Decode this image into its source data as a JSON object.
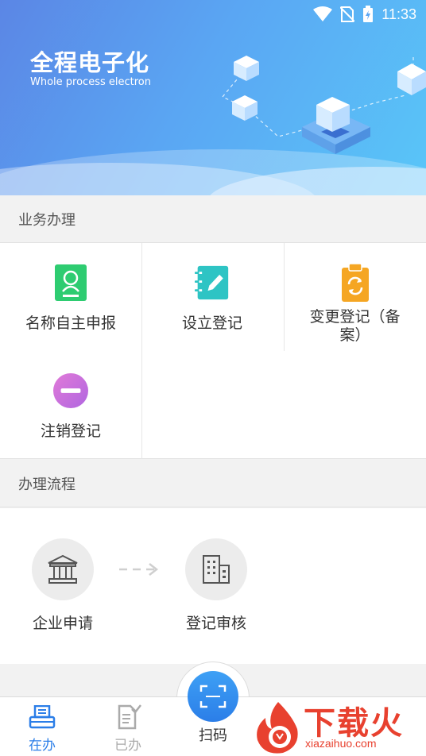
{
  "status_bar": {
    "time": "11:33",
    "icons": [
      "wifi-icon",
      "no-sim-icon",
      "battery-charging-icon"
    ]
  },
  "banner": {
    "title": "全程电子化",
    "subtitle": "Whole process electron"
  },
  "business": {
    "header": "业务办理",
    "items": [
      {
        "label": "名称自主申报",
        "icon": "id-card-icon",
        "color": "#2ecc71"
      },
      {
        "label": "设立登记",
        "icon": "notebook-edit-icon",
        "color": "#2ec4c4"
      },
      {
        "label": "变更登记（备案）",
        "icon": "clipboard-refresh-icon",
        "color": "#f5a623"
      },
      {
        "label": "注销登记",
        "icon": "minus-circle-icon",
        "color": "#c86dd7"
      }
    ]
  },
  "process": {
    "header": "办理流程",
    "steps": [
      {
        "label": "企业申请",
        "icon": "bank-building-icon"
      },
      {
        "label": "登记审核",
        "icon": "office-building-icon"
      }
    ]
  },
  "bottom_nav": {
    "items": [
      {
        "label": "在办",
        "icon": "printer-doc-icon",
        "active": true
      },
      {
        "label": "已办",
        "icon": "doc-check-icon",
        "active": false
      }
    ],
    "scan_label": "扫码"
  },
  "watermark": {
    "brand": "下载火",
    "url": "xiazaihuo.com"
  },
  "colors": {
    "accent": "#2b7ee8",
    "active_nav": "#2b7ee8",
    "inactive_nav": "#aaaaaa"
  }
}
